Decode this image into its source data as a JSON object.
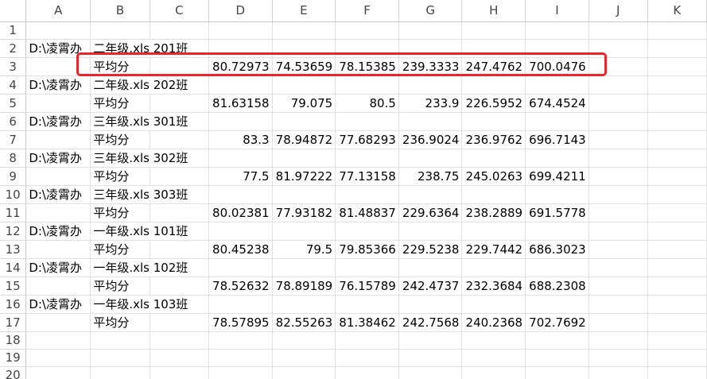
{
  "columns": [
    "A",
    "B",
    "C",
    "D",
    "E",
    "F",
    "G",
    "H",
    "I",
    "J",
    "K"
  ],
  "rows": [
    {
      "n": "1",
      "a": "",
      "b": "",
      "d": "",
      "e": "",
      "f": "",
      "g": "",
      "h": "",
      "i": ""
    },
    {
      "n": "2",
      "a": "D:\\凌霄办",
      "b": "二年级.xls 201班",
      "d": "",
      "e": "",
      "f": "",
      "g": "",
      "h": "",
      "i": ""
    },
    {
      "n": "3",
      "a": "",
      "b": "平均分",
      "d": "80.72973",
      "e": "74.53659",
      "f": "78.15385",
      "g": "239.3333",
      "h": "247.4762",
      "i": "700.0476"
    },
    {
      "n": "4",
      "a": "D:\\凌霄办",
      "b": "二年级.xls 202班",
      "d": "",
      "e": "",
      "f": "",
      "g": "",
      "h": "",
      "i": ""
    },
    {
      "n": "5",
      "a": "",
      "b": "平均分",
      "d": "81.63158",
      "e": "79.075",
      "f": "80.5",
      "g": "233.9",
      "h": "226.5952",
      "i": "674.4524"
    },
    {
      "n": "6",
      "a": "D:\\凌霄办",
      "b": "三年级.xls 301班",
      "d": "",
      "e": "",
      "f": "",
      "g": "",
      "h": "",
      "i": ""
    },
    {
      "n": "7",
      "a": "",
      "b": "平均分",
      "d": "83.3",
      "e": "78.94872",
      "f": "77.68293",
      "g": "236.9024",
      "h": "236.9762",
      "i": "696.7143"
    },
    {
      "n": "8",
      "a": "D:\\凌霄办",
      "b": "三年级.xls 302班",
      "d": "",
      "e": "",
      "f": "",
      "g": "",
      "h": "",
      "i": ""
    },
    {
      "n": "9",
      "a": "",
      "b": "平均分",
      "d": "77.5",
      "e": "81.97222",
      "f": "77.13158",
      "g": "238.75",
      "h": "245.0263",
      "i": "699.4211"
    },
    {
      "n": "10",
      "a": "D:\\凌霄办",
      "b": "三年级.xls 303班",
      "d": "",
      "e": "",
      "f": "",
      "g": "",
      "h": "",
      "i": ""
    },
    {
      "n": "11",
      "a": "",
      "b": "平均分",
      "d": "80.02381",
      "e": "77.93182",
      "f": "81.48837",
      "g": "229.6364",
      "h": "238.2889",
      "i": "691.5778"
    },
    {
      "n": "12",
      "a": "D:\\凌霄办",
      "b": "一年级.xls 101班",
      "d": "",
      "e": "",
      "f": "",
      "g": "",
      "h": "",
      "i": ""
    },
    {
      "n": "13",
      "a": "",
      "b": "平均分",
      "d": "80.45238",
      "e": "79.5",
      "f": "79.85366",
      "g": "229.5238",
      "h": "229.7442",
      "i": "686.3023"
    },
    {
      "n": "14",
      "a": "D:\\凌霄办",
      "b": "一年级.xls 102班",
      "d": "",
      "e": "",
      "f": "",
      "g": "",
      "h": "",
      "i": ""
    },
    {
      "n": "15",
      "a": "",
      "b": "平均分",
      "d": "78.52632",
      "e": "78.89189",
      "f": "76.15789",
      "g": "242.4737",
      "h": "232.3684",
      "i": "688.2308"
    },
    {
      "n": "16",
      "a": "D:\\凌霄办",
      "b": "一年级.xls 103班",
      "d": "",
      "e": "",
      "f": "",
      "g": "",
      "h": "",
      "i": ""
    },
    {
      "n": "17",
      "a": "",
      "b": "平均分",
      "d": "78.57895",
      "e": "82.55263",
      "f": "81.38462",
      "g": "242.7568",
      "h": "240.2368",
      "i": "702.7692"
    },
    {
      "n": "18",
      "a": "",
      "b": "",
      "d": "",
      "e": "",
      "f": "",
      "g": "",
      "h": "",
      "i": ""
    },
    {
      "n": "19",
      "a": "",
      "b": "",
      "d": "",
      "e": "",
      "f": "",
      "g": "",
      "h": "",
      "i": ""
    },
    {
      "n": "20",
      "a": "",
      "b": "",
      "d": "",
      "e": "",
      "f": "",
      "g": "",
      "h": "",
      "i": ""
    }
  ],
  "colors": {
    "highlight_border": "#e8262b",
    "grid_line": "#e1e1e1",
    "header_text": "#444444"
  }
}
